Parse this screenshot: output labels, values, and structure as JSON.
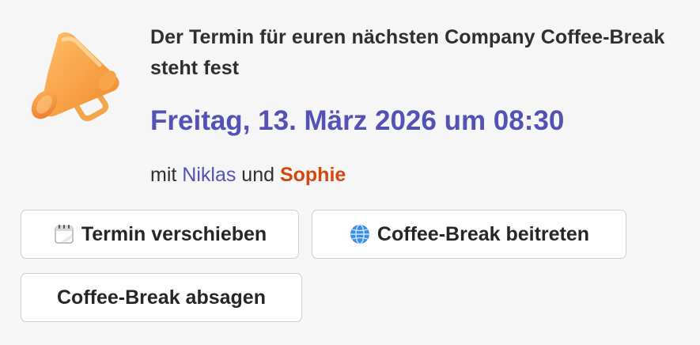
{
  "message": {
    "headline": "Der Termin für euren nächsten Company Coffee-Break steht fest",
    "date_text": "Freitag, 13. März 2026 um 08:30",
    "with_prefix": "mit ",
    "participant_1": "Niklas",
    "conjunction": " und ",
    "participant_2": "Sophie"
  },
  "buttons": {
    "reschedule_label": "Termin verschieben",
    "join_label": "Coffee-Break beitreten",
    "cancel_label": "Coffee-Break absagen"
  },
  "icons": {
    "megaphone": "megaphone-icon",
    "calendar": "calendar-icon",
    "globe": "globe-icon"
  },
  "colors": {
    "accent": "#5552b6",
    "participant_highlight": "#d3460d",
    "megaphone_orange": "#f39a3c"
  }
}
